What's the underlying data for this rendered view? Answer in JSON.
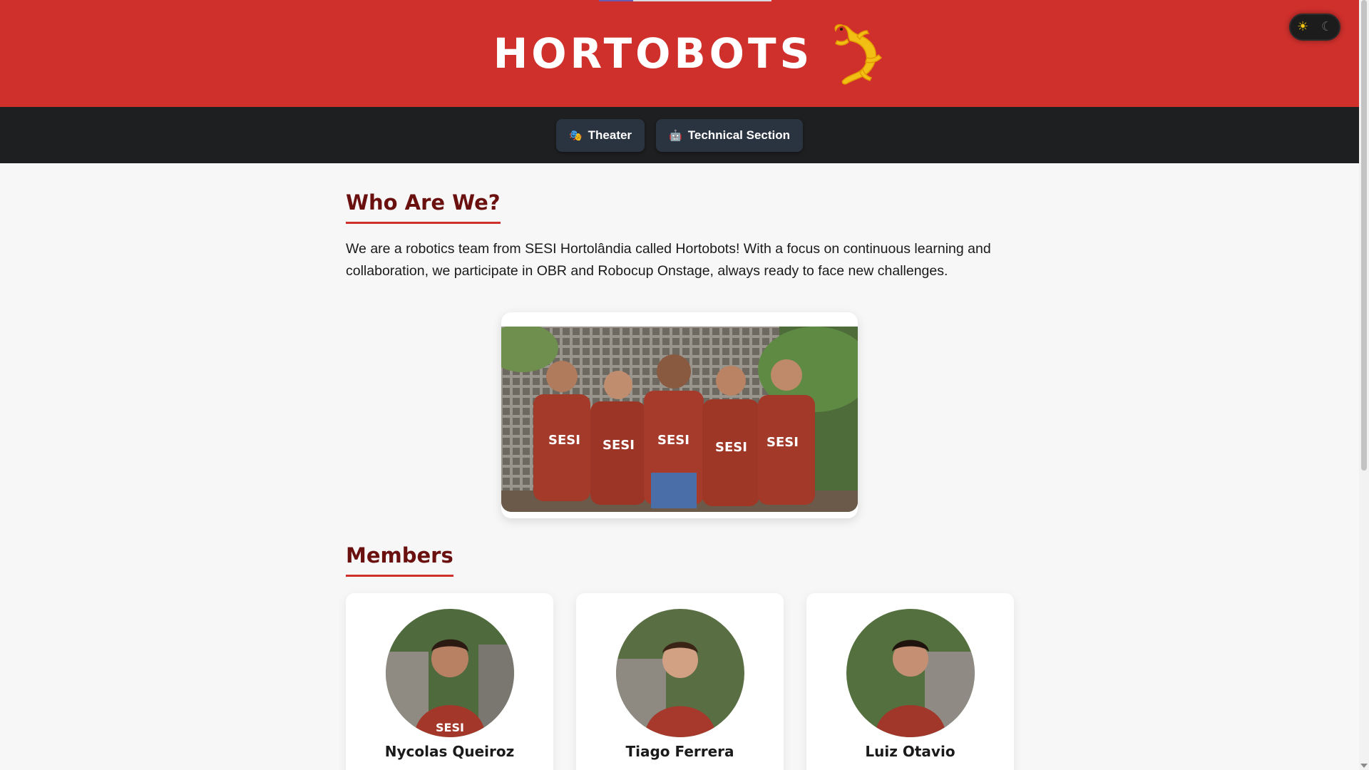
{
  "header": {
    "title": "HORTOBOTS",
    "logo_icon": "salamander-logo-icon"
  },
  "theme_toggle": {
    "light_icon": "☀",
    "dark_icon": "☾"
  },
  "nav": {
    "items": [
      {
        "label": "Theater",
        "icon": "🎭"
      },
      {
        "label": "Technical Section",
        "icon": "🤖"
      }
    ]
  },
  "about": {
    "title": "Who Are We?",
    "text": "We are a robotics team from SESI Hortolândia called Hortobots! With a focus on continuous learning and collaboration, we participate in OBR and Robocup Onstage, always ready to face new challenges."
  },
  "members": {
    "title": "Members",
    "list": [
      {
        "name": "Nycolas Queiroz"
      },
      {
        "name": "Tiago Ferrera"
      },
      {
        "name": "Luiz Otavio"
      }
    ]
  },
  "colors": {
    "brand_red": "#cf302c",
    "navbar": "#1e1f20",
    "heading": "#6a1110"
  }
}
